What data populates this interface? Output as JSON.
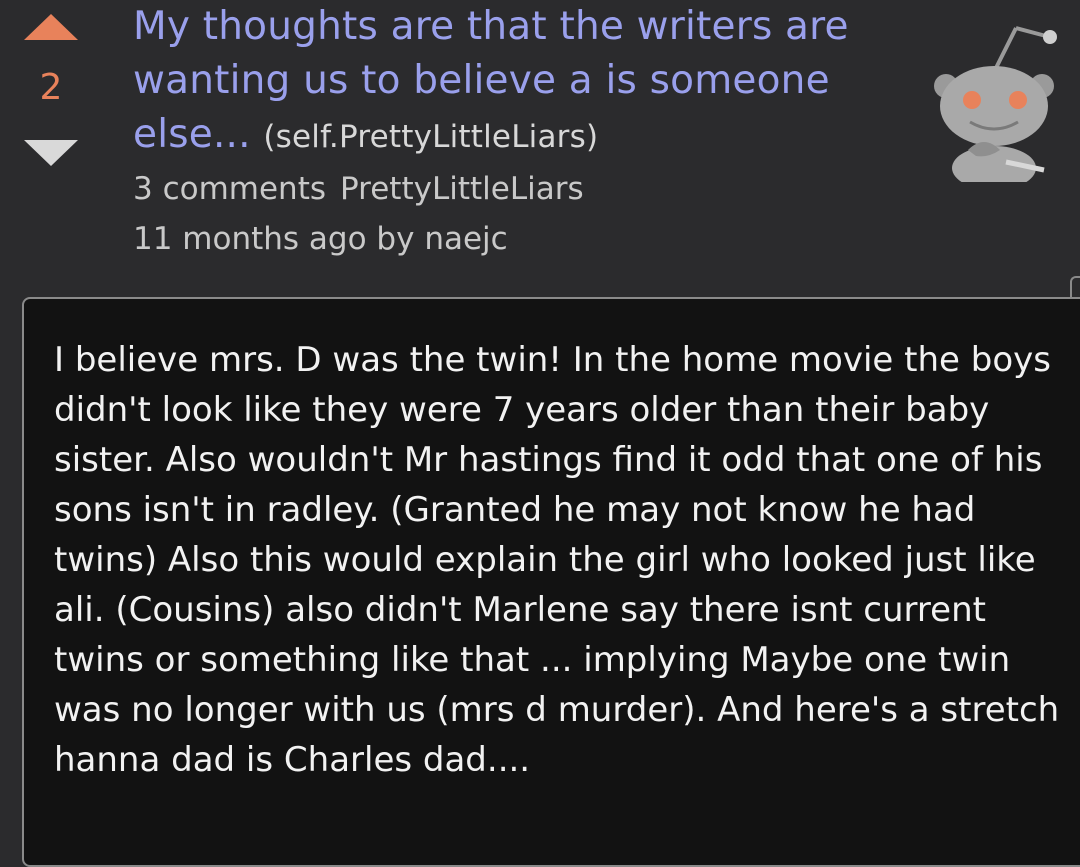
{
  "post": {
    "score": "2",
    "title": "My thoughts are that the writers are wanting us to believe a is someone else...",
    "domain": "(self.PrettyLittleLiars)",
    "comments": "3 comments",
    "subreddit": "PrettyLittleLiars",
    "age": "11 months ago",
    "author_prefix": "by",
    "author": "naejc",
    "thumbnail_icon": "reddit-alien-icon",
    "colors": {
      "upvote": "#e8825b",
      "title": "#9aa0ec",
      "background": "#2b2b2d"
    }
  },
  "comment": {
    "text": "I believe mrs. D was the twin! In the home movie the boys didn't look like they were 7 years older than their baby sister. Also wouldn't Mr hastings find it odd that one of his sons isn't in radley. (Granted he may not know he had twins) Also this would explain the girl who looked just like ali. (Cousins) also didn't Marlene say there isnt current twins or something like that ... implying Maybe one twin was no longer with us (mrs d murder). And here's a stretch hanna dad is Charles dad...."
  }
}
